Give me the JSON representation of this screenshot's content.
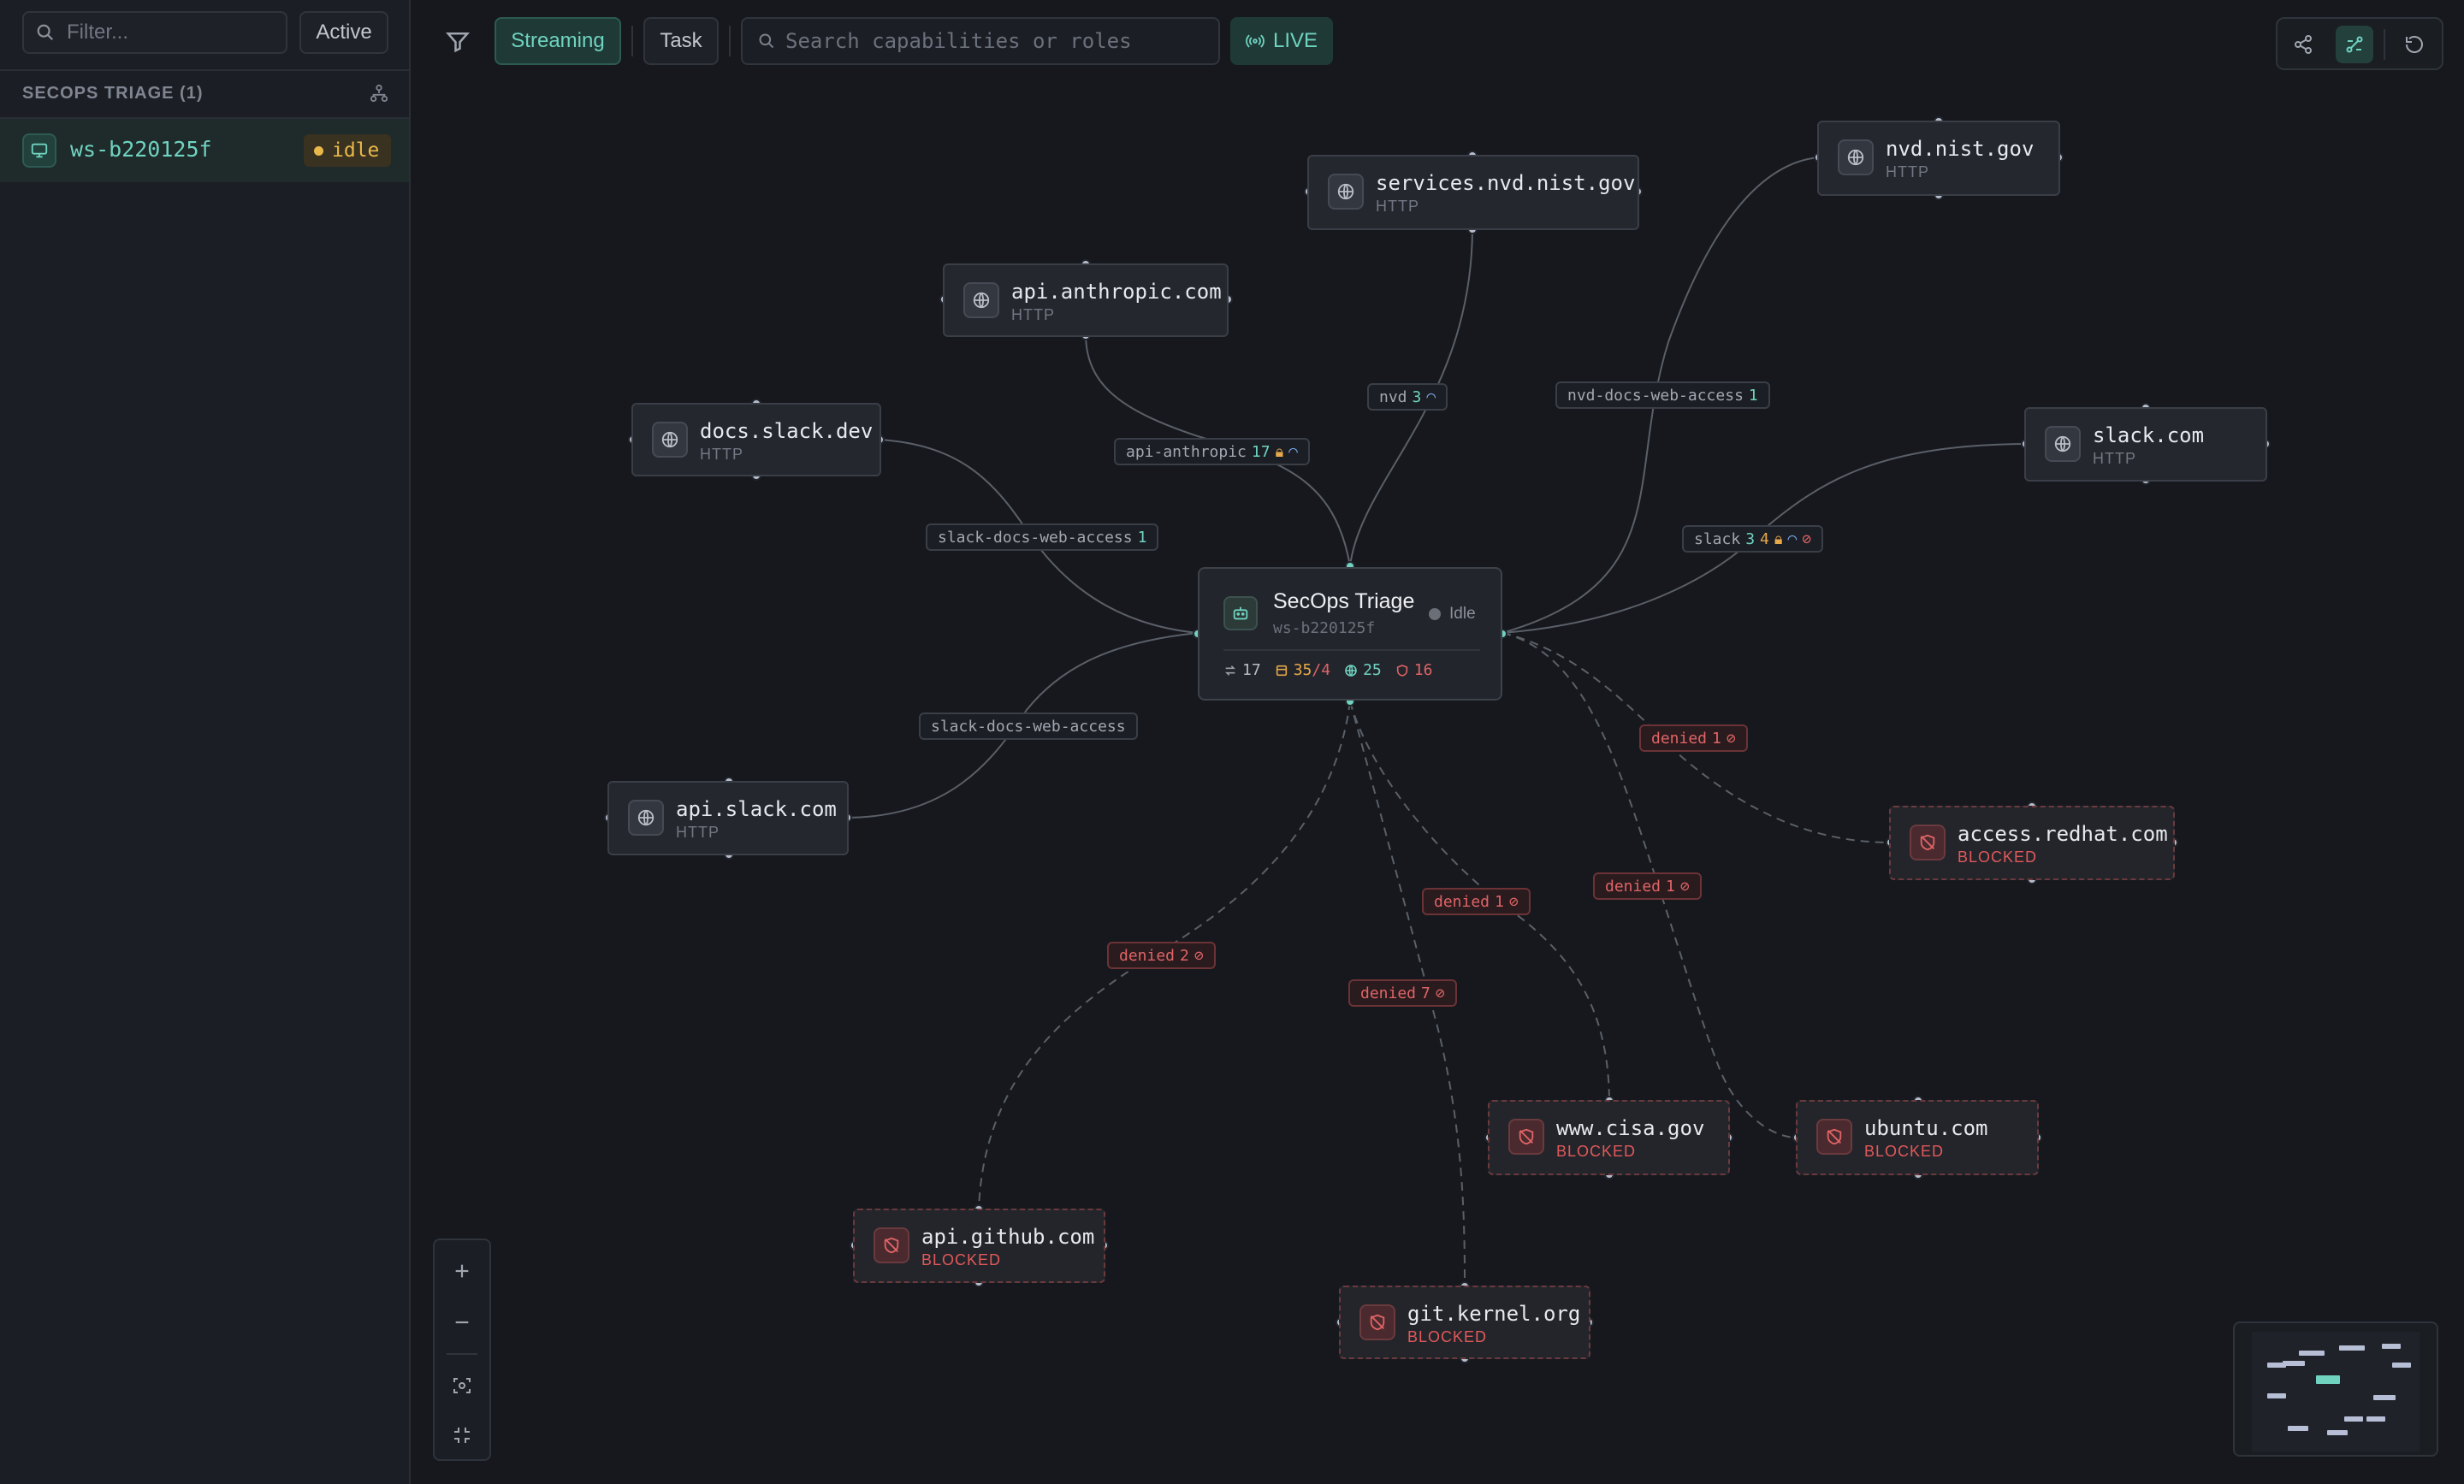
{
  "sidebar": {
    "filter_placeholder": "Filter...",
    "active_label": "Active",
    "group_header": "SECOPS TRIAGE (1)",
    "workspace": {
      "name": "ws-b220125f",
      "status": "idle"
    }
  },
  "toolbar": {
    "streaming_label": "Streaming",
    "task_label": "Task",
    "search_placeholder": "Search capabilities or roles",
    "live_label": "LIVE"
  },
  "central": {
    "title": "SecOps Triage",
    "subtitle": "ws-b220125f",
    "status": "Idle",
    "stats": {
      "edges": "17",
      "sessions": "35",
      "sessions_total": "/4",
      "web": "25",
      "denied": "16"
    }
  },
  "nodes": {
    "services_nvd": {
      "title": "services.nvd.nist.gov",
      "sub": "HTTP"
    },
    "nvd_nist": {
      "title": "nvd.nist.gov",
      "sub": "HTTP"
    },
    "api_anthropic": {
      "title": "api.anthropic.com",
      "sub": "HTTP"
    },
    "docs_slack": {
      "title": "docs.slack.dev",
      "sub": "HTTP"
    },
    "slack_com": {
      "title": "slack.com",
      "sub": "HTTP"
    },
    "api_slack": {
      "title": "api.slack.com",
      "sub": "HTTP"
    },
    "access_redhat": {
      "title": "access.redhat.com",
      "sub": "BLOCKED"
    },
    "cisa": {
      "title": "www.cisa.gov",
      "sub": "BLOCKED"
    },
    "ubuntu": {
      "title": "ubuntu.com",
      "sub": "BLOCKED"
    },
    "github": {
      "title": "api.github.com",
      "sub": "BLOCKED"
    },
    "kernel": {
      "title": "git.kernel.org",
      "sub": "BLOCKED"
    }
  },
  "edges": {
    "nvd": {
      "name": "nvd",
      "count": "3"
    },
    "nvd_docs": {
      "name": "nvd-docs-web-access",
      "count": "1"
    },
    "anthropic": {
      "name": "api-anthropic",
      "count": "17"
    },
    "slack_docs_1": {
      "name": "slack-docs-web-access",
      "count": "1"
    },
    "slack": {
      "name": "slack",
      "count": "3",
      "count2": "4"
    },
    "slack_docs_2": {
      "name": "slack-docs-web-access"
    },
    "denied_redhat": {
      "name": "denied",
      "count": "1"
    },
    "denied_ubuntu": {
      "name": "denied",
      "count": "1"
    },
    "denied_cisa": {
      "name": "denied",
      "count": "1"
    },
    "denied_github": {
      "name": "denied",
      "count": "2"
    },
    "denied_kernel": {
      "name": "denied",
      "count": "7"
    }
  },
  "colors": {
    "accent": "#6fd3c0",
    "denied": "#e06466",
    "warning": "#e8b84a",
    "background": "#16181d"
  },
  "icons": {
    "node_allowed": "globe-icon",
    "node_blocked": "blocked-icon",
    "central": "bot-icon"
  }
}
